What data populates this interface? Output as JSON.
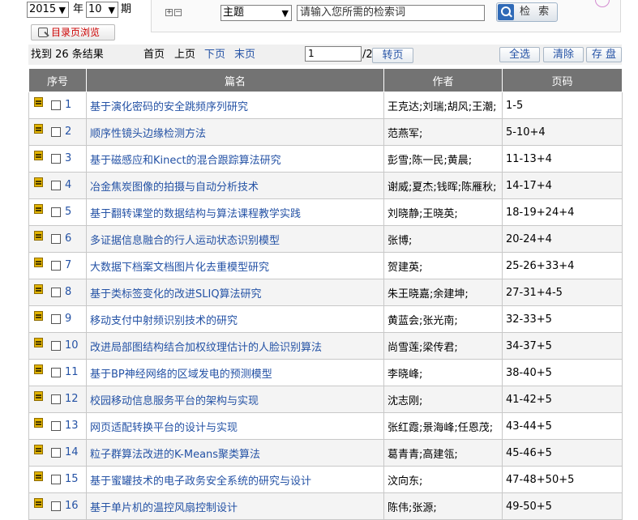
{
  "filters": {
    "year": "2015",
    "year_label": "年",
    "issue": "10",
    "issue_label": "期",
    "catalog_button": "目录页浏览"
  },
  "search": {
    "expand_glyph": "+",
    "collapse_glyph": "−",
    "field": "主题",
    "placeholder": "请输入您所需的检索词",
    "button": "检 索"
  },
  "toolbar": {
    "result_count": "找到 26 条结果",
    "first": "首页",
    "prev": "上页",
    "next": "下页",
    "last": "末页",
    "page_value": "1",
    "page_total": "/2",
    "goto": "转页",
    "select_all": "全选",
    "clear": "清除",
    "save": "存 盘"
  },
  "table": {
    "headers": [
      "序号",
      "篇名",
      "作者",
      "页码"
    ],
    "rows": [
      {
        "num": "1",
        "title": "基于演化密码的安全跳频序列研究",
        "authors": "王克达;刘瑞;胡风;王潮;",
        "pages": "1-5"
      },
      {
        "num": "2",
        "title": "顺序性镜头边缘检测方法",
        "authors": "范燕军;",
        "pages": "5-10+4"
      },
      {
        "num": "3",
        "title": "基于磁感应和Kinect的混合跟踪算法研究",
        "authors": "彭雪;陈一民;黄晨;",
        "pages": "11-13+4"
      },
      {
        "num": "4",
        "title": "冶金焦炭图像的拍摄与自动分析技术",
        "authors": "谢威;夏杰;钱晖;陈雁秋;",
        "pages": "14-17+4"
      },
      {
        "num": "5",
        "title": "基于翻转课堂的数据结构与算法课程教学实践",
        "authors": "刘晓静;王晓英;",
        "pages": "18-19+24+4"
      },
      {
        "num": "6",
        "title": "多证据信息融合的行人运动状态识别模型",
        "authors": "张博;",
        "pages": "20-24+4"
      },
      {
        "num": "7",
        "title": "大数据下档案文档图片化去重模型研究",
        "authors": "贺建英;",
        "pages": "25-26+33+4"
      },
      {
        "num": "8",
        "title": "基于类标签变化的改进SLIQ算法研究",
        "authors": "朱王晓嘉;余建坤;",
        "pages": "27-31+4-5"
      },
      {
        "num": "9",
        "title": "移动支付中射频识别技术的研究",
        "authors": "黄蓝会;张光南;",
        "pages": "32-33+5"
      },
      {
        "num": "10",
        "title": "改进局部图结构结合加权纹理估计的人脸识别算法",
        "authors": "尚雪莲;梁传君;",
        "pages": "34-37+5"
      },
      {
        "num": "11",
        "title": "基于BP神经网络的区域发电的预测模型",
        "authors": "李晓峰;",
        "pages": "38-40+5"
      },
      {
        "num": "12",
        "title": "校园移动信息服务平台的架构与实现",
        "authors": "沈志刚;",
        "pages": "41-42+5"
      },
      {
        "num": "13",
        "title": "网页适配转换平台的设计与实现",
        "authors": "张红霞;景海峰;任恩茂;",
        "pages": "43-44+5"
      },
      {
        "num": "14",
        "title": "粒子群算法改进的K-Means聚类算法",
        "authors": "葛青青;高建瓴;",
        "pages": "45-46+5"
      },
      {
        "num": "15",
        "title": "基于蜜罐技术的电子政务安全系统的研究与设计",
        "authors": "汶向东;",
        "pages": "47-48+50+5"
      },
      {
        "num": "16",
        "title": "基于单片机的温控风扇控制设计",
        "authors": "陈伟;张源;",
        "pages": "49-50+5"
      }
    ]
  }
}
